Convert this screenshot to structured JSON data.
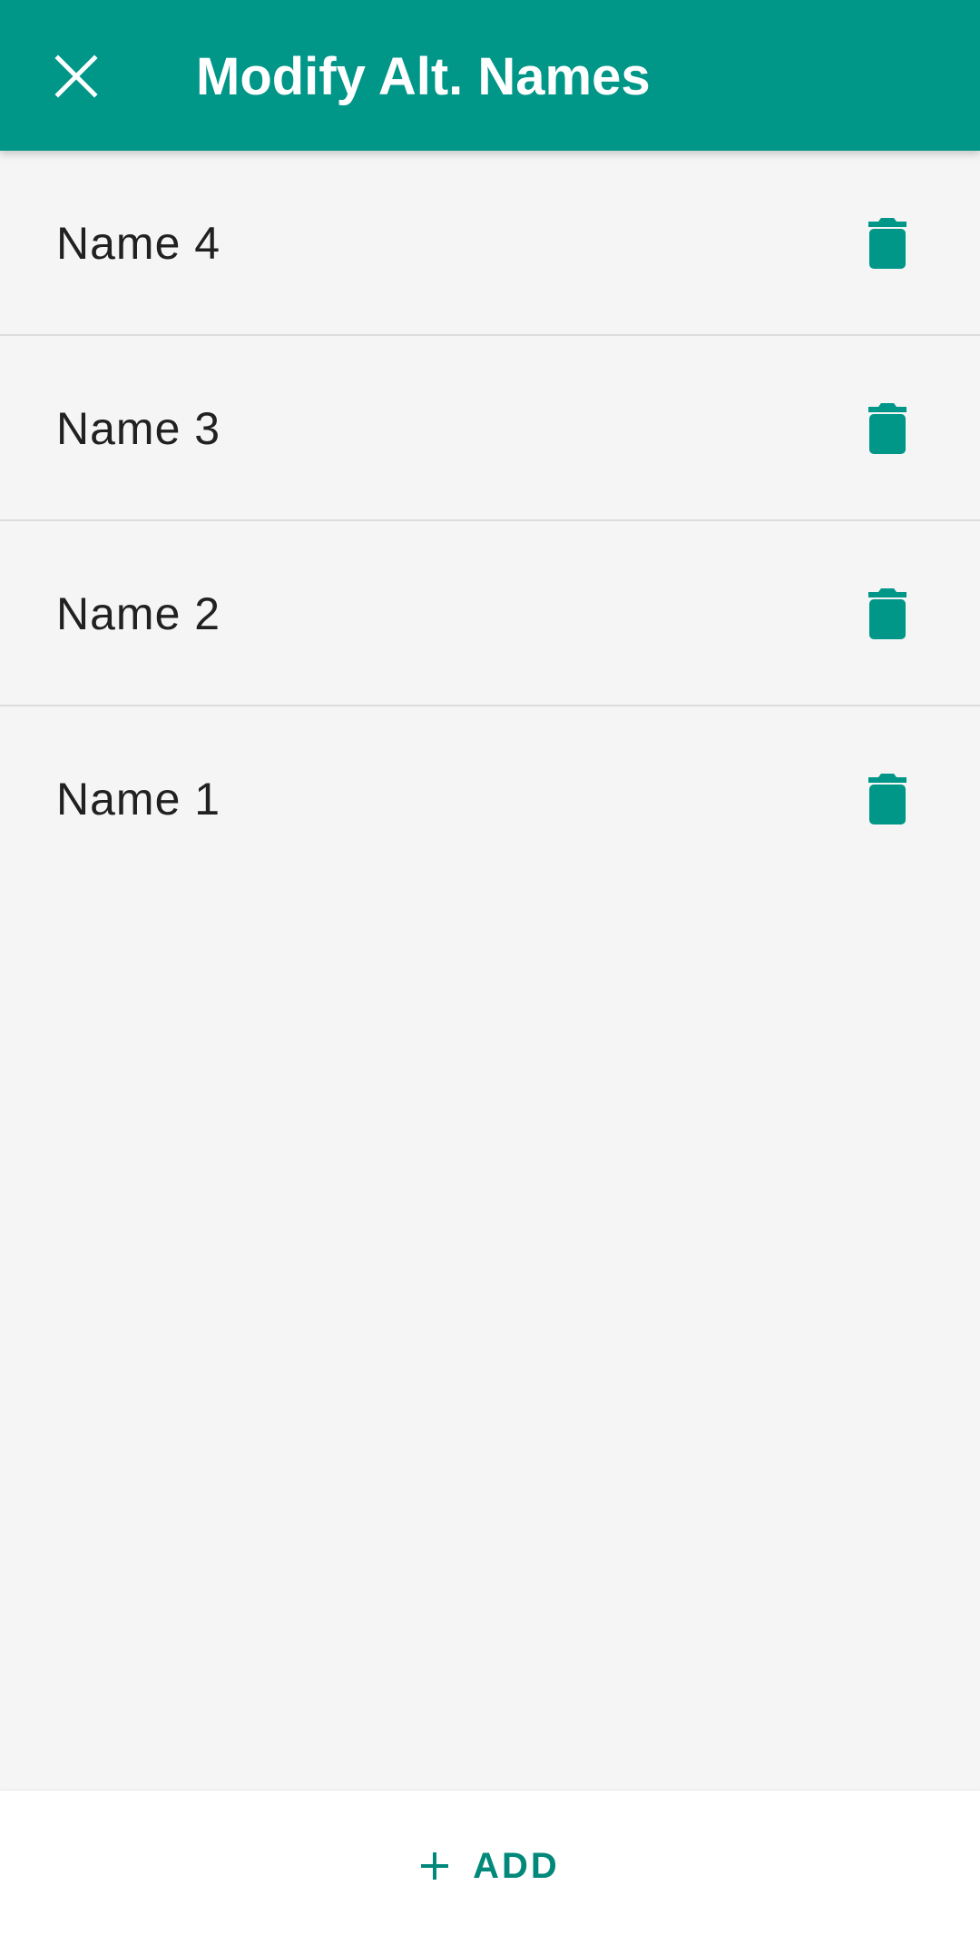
{
  "app_bar": {
    "title": "Modify Alt. Names",
    "close_icon": "close-icon",
    "background": "#009688"
  },
  "names": [
    {
      "label": "Name 4",
      "icon": "trash-icon"
    },
    {
      "label": "Name 3",
      "icon": "trash-icon"
    },
    {
      "label": "Name 2",
      "icon": "trash-icon"
    },
    {
      "label": "Name 1",
      "icon": "trash-icon"
    }
  ],
  "bottom_bar": {
    "add_label": "ADD",
    "add_icon": "plus-icon"
  },
  "colors": {
    "accent": "#009688",
    "list_background": "#f5f5f5",
    "text": "#212121"
  }
}
